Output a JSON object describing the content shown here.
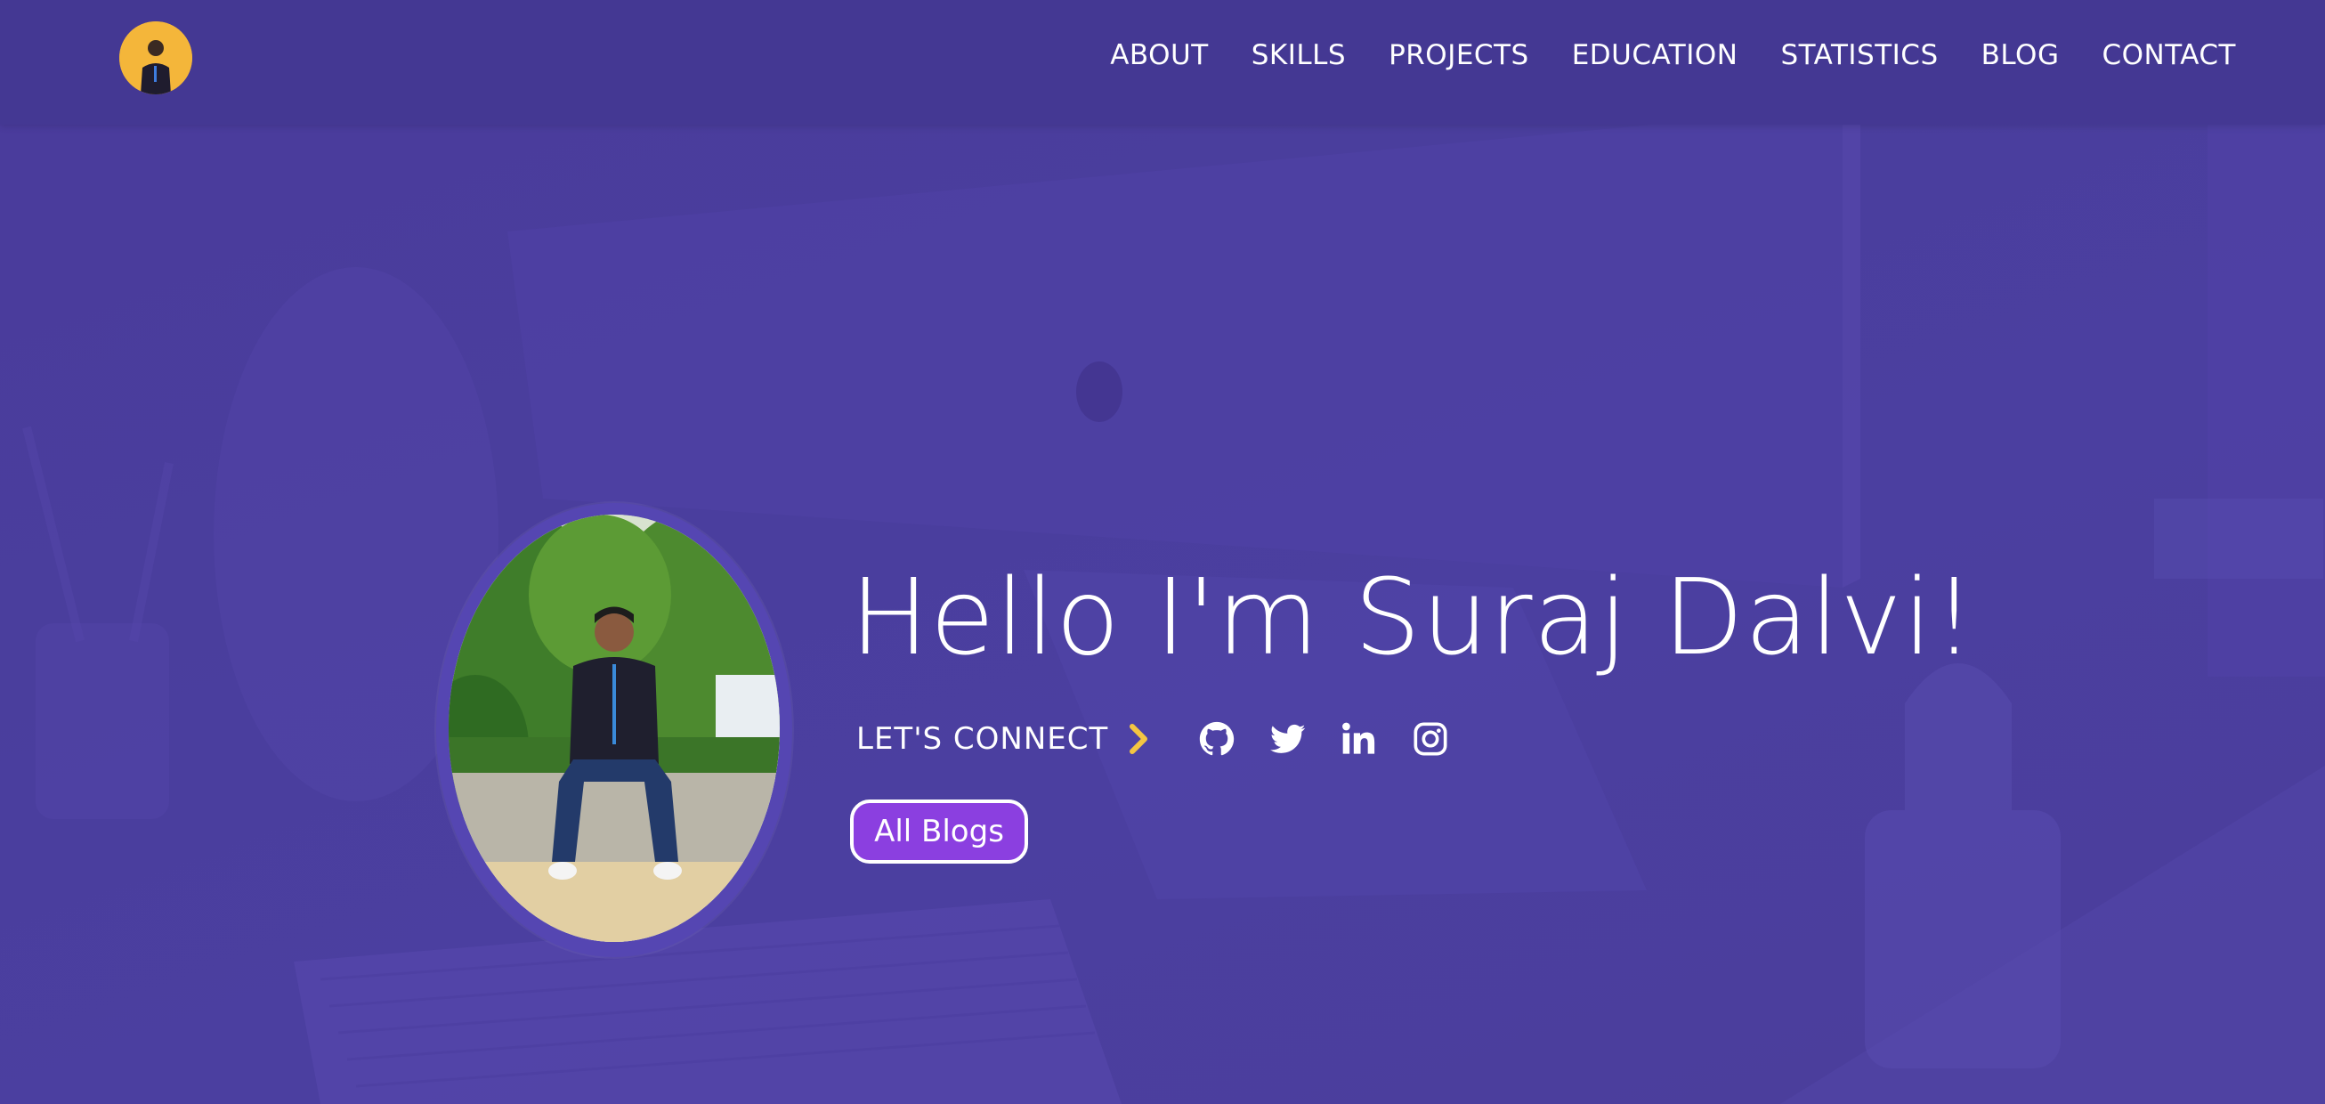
{
  "nav": {
    "links": [
      "ABOUT",
      "SKILLS",
      "PROJECTS",
      "EDUCATION",
      "STATISTICS",
      "BLOG",
      "CONTACT"
    ]
  },
  "hero": {
    "title": "Hello I'm Suraj Dalvi!",
    "connect_label": "LET'S CONNECT",
    "social_icons": [
      "github-icon",
      "twitter-icon",
      "linkedin-icon",
      "instagram-icon"
    ],
    "button_label": "All Blogs"
  },
  "colors": {
    "background": "#4a3e9d",
    "navbar": "#443893",
    "accent_chevron": "#f4c542",
    "button": "#8b3fe0",
    "logo_bg": "#f4b63a"
  }
}
